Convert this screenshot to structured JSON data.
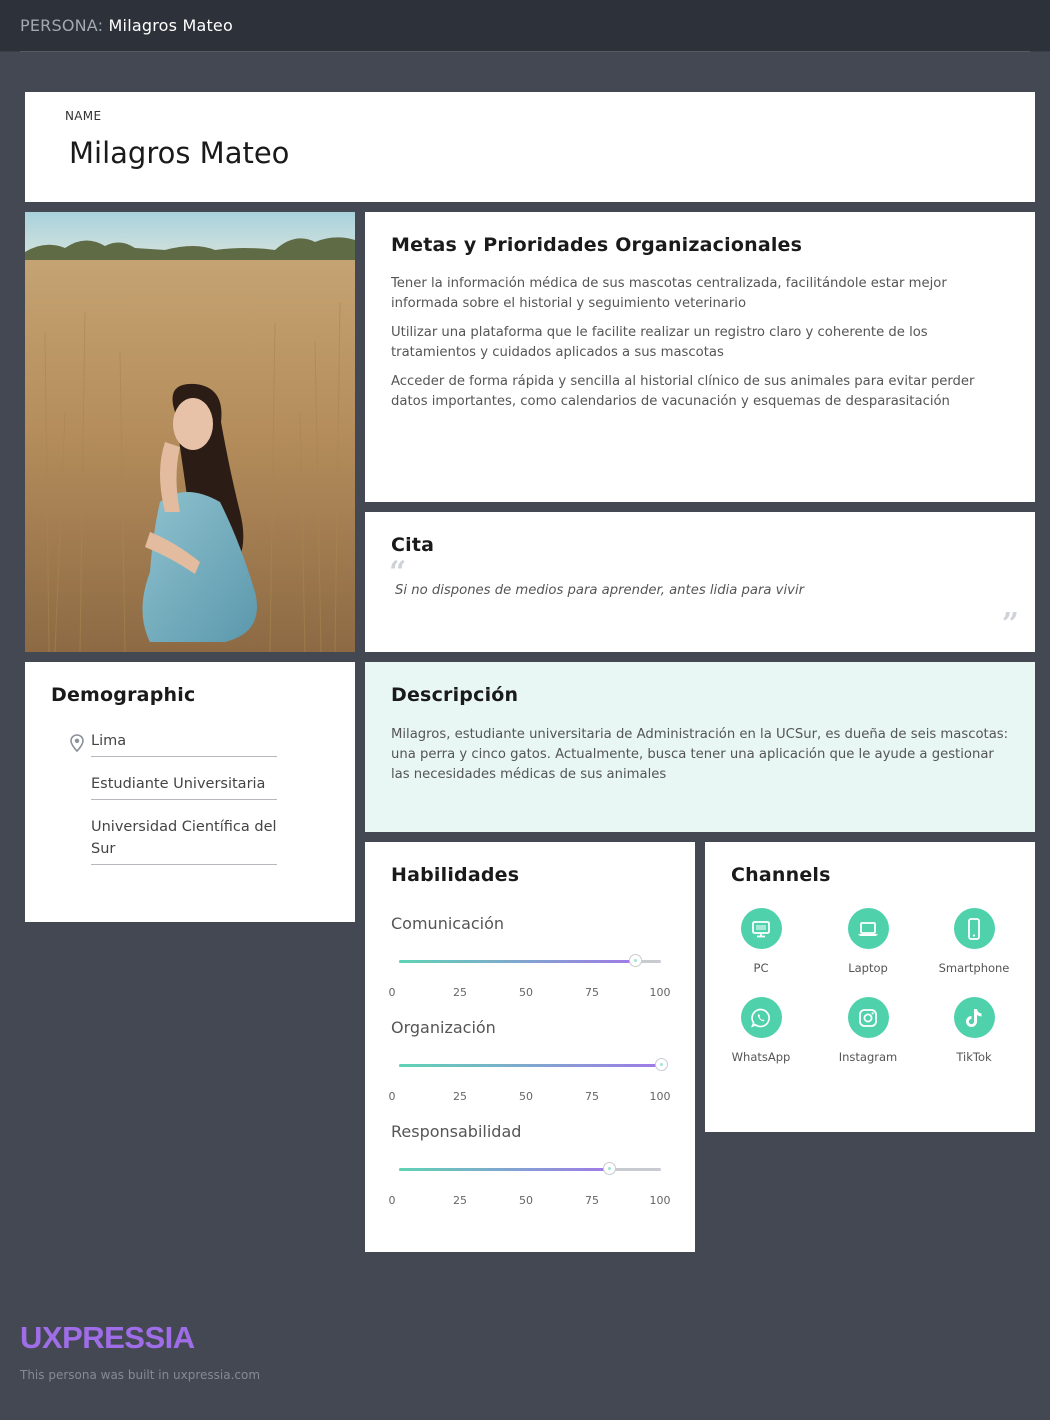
{
  "header": {
    "prefix": "PERSONA:",
    "name": "Milagros Mateo"
  },
  "name_card": {
    "label": "NAME",
    "value": "Milagros Mateo"
  },
  "photo": {
    "icon": "persona-photo"
  },
  "goals": {
    "title": "Metas y Prioridades Organizacionales",
    "items": [
      "Tener la información médica de sus mascotas centralizada, facilitándole estar mejor informada sobre el historial y seguimiento veterinario",
      "Utilizar una plataforma que le facilite realizar un registro claro y coherente de los tratamientos y cuidados aplicados a sus mascotas",
      "Acceder de forma rápida y sencilla al historial clínico de sus animales para evitar perder datos importantes, como calendarios de vacunación y esquemas de desparasitación"
    ]
  },
  "quote": {
    "title": "Cita",
    "open_mark": "“",
    "close_mark": "”",
    "text": "Si no dispones de medios para aprender, antes lidia para vivir"
  },
  "demographic": {
    "title": "Demographic",
    "location_icon": "map-pin-icon",
    "items": [
      "Lima",
      "Estudiante Universitaria",
      "Universidad Científica del Sur"
    ]
  },
  "description": {
    "title": "Descripción",
    "text": "Milagros, estudiante universitaria de Administración en la UCSur, es dueña de seis mascotas: una perra y cinco gatos. Actualmente, busca tener una aplicación que le ayude a gestionar las necesidades médicas de sus animales"
  },
  "skills": {
    "title": "Habilidades",
    "scale": [
      "0",
      "25",
      "50",
      "75",
      "100"
    ],
    "items": [
      {
        "name": "Comunicación",
        "value": 90
      },
      {
        "name": "Organización",
        "value": 100
      },
      {
        "name": "Responsabilidad",
        "value": 80
      }
    ]
  },
  "channels": {
    "title": "Channels",
    "accent": "#4fd1ac",
    "items": [
      {
        "label": "PC",
        "icon": "monitor-icon"
      },
      {
        "label": "Laptop",
        "icon": "laptop-icon"
      },
      {
        "label": "Smartphone",
        "icon": "smartphone-icon"
      },
      {
        "label": "WhatsApp",
        "icon": "whatsapp-icon"
      },
      {
        "label": "Instagram",
        "icon": "instagram-icon"
      },
      {
        "label": "TikTok",
        "icon": "tiktok-icon"
      }
    ]
  },
  "footer": {
    "brand": "UXPRESSIA",
    "note": "This persona was built in uxpressia.com",
    "brand_color": "#a06de8"
  }
}
